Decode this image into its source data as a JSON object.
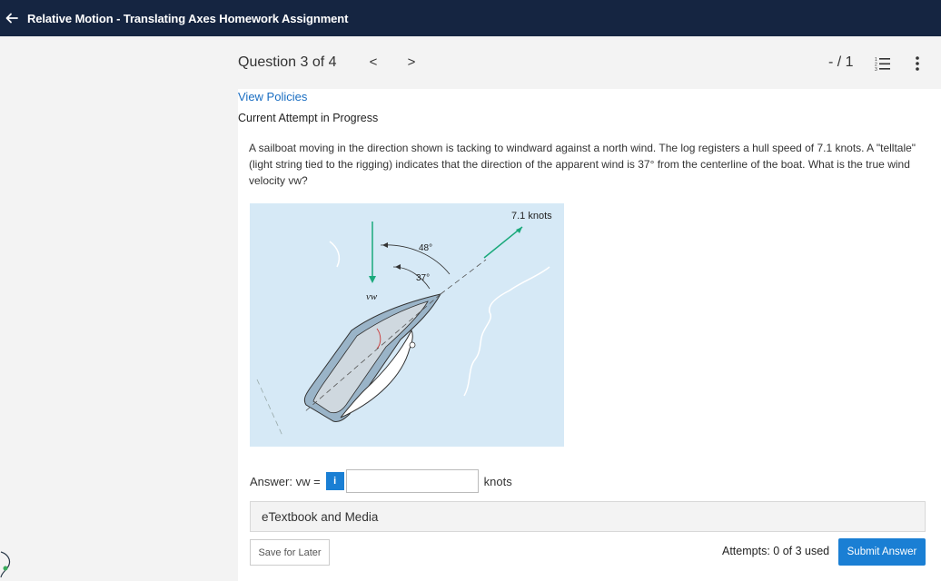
{
  "topbar": {
    "title": "Relative Motion - Translating Axes Homework Assignment"
  },
  "question_header": {
    "label": "Question 3 of 4",
    "prev": "<",
    "next": ">",
    "score": "- / 1"
  },
  "content": {
    "view_policies": "View Policies",
    "attempt_status": "Current Attempt in Progress",
    "question_text": "A sailboat moving in the direction shown is tacking to windward against a north wind. The log registers a hull speed of 7.1 knots. A \"telltale\" (light string tied to the rigging) indicates that the direction of the apparent wind is 37° from the centerline of the boat. What is the true wind velocity vw?",
    "figure": {
      "speed_label": "7.1 knots",
      "angle_outer": "48°",
      "angle_inner": "37°",
      "wind_label": "vw"
    },
    "answer": {
      "label": "Answer: vw =",
      "info": "i",
      "value": "",
      "unit": "knots"
    },
    "etextbook": "eTextbook and Media",
    "save_for_later": "Save for Later",
    "attempts": "Attempts: 0 of 3 used",
    "submit": "Submit Answer"
  },
  "colors": {
    "topbar": "#152541",
    "accent": "#1a7fd4",
    "link": "#1a6ec2",
    "water": "#d6e9f6",
    "arrow_green": "#1aa97b"
  },
  "icons": {
    "back": "arrow-left-icon",
    "list": "list-icon",
    "more": "more-vertical-icon",
    "info": "info-icon",
    "sidebar": "sidebar-badge-icon"
  }
}
